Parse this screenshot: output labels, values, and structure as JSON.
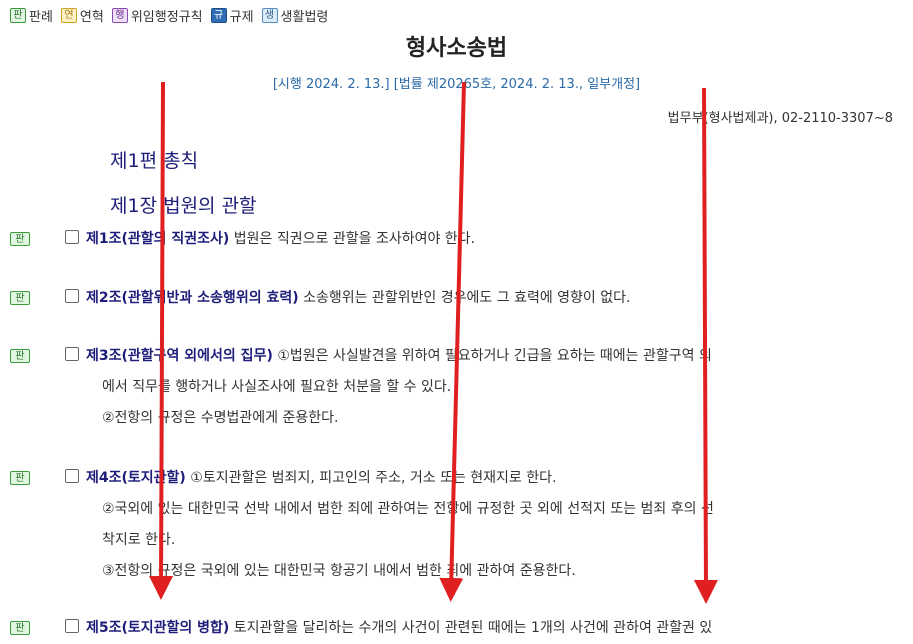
{
  "legend": [
    {
      "badge": "판",
      "label": "판례",
      "icon": "precedent-icon",
      "cls": "b-pan"
    },
    {
      "badge": "연",
      "label": "연혁",
      "icon": "history-icon",
      "cls": "b-yeon"
    },
    {
      "badge": "행",
      "label": "위임행정규칙",
      "icon": "admin-rule-icon",
      "cls": "b-haeng"
    },
    {
      "badge": "규",
      "label": "규제",
      "icon": "regulation-icon",
      "cls": "b-gyu"
    },
    {
      "badge": "생",
      "label": "생활법령",
      "icon": "living-law-icon",
      "cls": "b-saeng"
    }
  ],
  "law": {
    "title": "형사소송법",
    "subtitle": "[시행 2024. 2. 13.] [법률 제20265호, 2024. 2. 13., 일부개정]",
    "ministry": "법무부(형사법제과), 02-2110-3307~8"
  },
  "parts": {
    "part1": "제1편 총칙",
    "chapter1": "제1장 법원의 관할"
  },
  "article_badge": "판",
  "articles": [
    {
      "title": "제1조(관할의 직권조사)",
      "lines": [
        "법원은 직권으로 관할을 조사하여야 한다."
      ]
    },
    {
      "title": "제2조(관할위반과 소송행위의 효력)",
      "lines": [
        "소송행위는 관할위반인 경우에도 그 효력에 영향이 없다."
      ]
    },
    {
      "title": "제3조(관할구역 외에서의 집무)",
      "lines": [
        "①법원은 사실발견을 위하여 필요하거나 긴급을 요하는 때에는 관할구역 외",
        "에서 직무를 행하거나 사실조사에 필요한 처분을 할 수 있다.",
        "②전항의 규정은 수명법관에게 준용한다."
      ]
    },
    {
      "title": "제4조(토지관할)",
      "lines": [
        "①토지관할은 범죄지, 피고인의 주소, 거소 또는 현재지로 한다.",
        "②국외에 있는 대한민국 선박 내에서 범한 죄에 관하여는 전항에 규정한 곳 외에 선적지 또는 범죄 후의 선",
        "착지로 한다.",
        "③전항의 규정은 국외에 있는 대한민국 항공기 내에서 범한 죄에 관하여 준용한다."
      ]
    },
    {
      "title": "제5조(토지관할의 병합)",
      "lines": [
        "토지관할을 달리하는 수개의 사건이 관련된 때에는 1개의 사건에 관하여 관할권 있"
      ]
    }
  ],
  "colors": {
    "arrow": "#e02020",
    "article_title": "#1e1e7a",
    "subtitle": "#2a6aa8"
  }
}
